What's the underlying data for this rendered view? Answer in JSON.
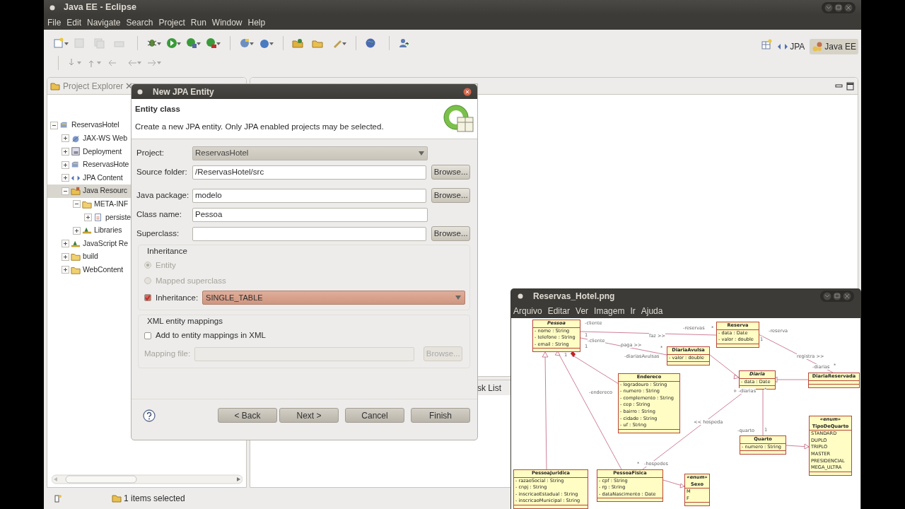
{
  "eclipse": {
    "title": "Java EE - Eclipse",
    "menu": [
      "File",
      "Edit",
      "Navigate",
      "Search",
      "Project",
      "Run",
      "Window",
      "Help"
    ],
    "perspectives": [
      {
        "label": "JPA",
        "selected": false
      },
      {
        "label": "Java EE",
        "selected": true
      }
    ],
    "project_explorer": {
      "title": "Project Explorer",
      "tree": [
        {
          "label": "ReservasHotel",
          "kind": "project",
          "expanded": true,
          "selected": false,
          "children": [
            {
              "label": "JAX-WS Web",
              "kind": "webservice",
              "expanded": false,
              "selected": false
            },
            {
              "label": "Deployment",
              "kind": "deployment",
              "expanded": false,
              "selected": false
            },
            {
              "label": "ReservasHote",
              "kind": "project",
              "expanded": false,
              "selected": false
            },
            {
              "label": "JPA Content",
              "kind": "jpa",
              "expanded": false,
              "selected": false
            },
            {
              "label": "Java Resourc",
              "kind": "resources",
              "expanded": true,
              "selected": true,
              "children": [
                {
                  "label": "META-INF",
                  "kind": "folder",
                  "expanded": true,
                  "selected": false,
                  "children": [
                    {
                      "label": "persiste",
                      "kind": "file",
                      "expanded": false,
                      "selected": false
                    }
                  ]
                },
                {
                  "label": "Libraries",
                  "kind": "library",
                  "expanded": false,
                  "selected": false
                }
              ]
            },
            {
              "label": "JavaScript Re",
              "kind": "library",
              "expanded": false,
              "selected": false
            },
            {
              "label": "build",
              "kind": "folder",
              "expanded": false,
              "selected": false
            },
            {
              "label": "WebContent",
              "kind": "folder",
              "expanded": false,
              "selected": false
            }
          ]
        }
      ]
    },
    "bottom_tab": "sk List",
    "status": "1 items selected"
  },
  "dialog": {
    "title": "New JPA Entity",
    "heading": "Entity class",
    "description": "Create a new JPA entity. Only JPA enabled projects may be selected.",
    "fields": [
      {
        "label": "Project:",
        "kind": "combo",
        "value": "ReservasHotel"
      },
      {
        "label": "Source folder:",
        "kind": "text",
        "value": "/ReservasHotel/src",
        "button": "Browse..."
      },
      {
        "label": "Java package:",
        "kind": "text",
        "value": "modelo",
        "button": "Browse..."
      },
      {
        "label": "Class name:",
        "kind": "text",
        "value": "Pessoa"
      },
      {
        "label": "Superclass:",
        "kind": "text",
        "button": "Browse..."
      }
    ],
    "inheritance": {
      "title": "Inheritance",
      "options": [
        {
          "label": "Entity",
          "selected": true,
          "disabled": true
        },
        {
          "label": "Mapped superclass",
          "selected": false,
          "disabled": true
        }
      ],
      "strategy": {
        "label": "Inheritance:",
        "checked": true,
        "value": "SINGLE_TABLE"
      }
    },
    "xml": {
      "title": "XML entity mappings",
      "add": {
        "label": "Add to entity mappings in XML",
        "checked": false
      },
      "mapping_file": {
        "label": "Mapping file:",
        "button": "Browse...",
        "disabled": true
      }
    },
    "buttons": [
      "< Back",
      "Next >",
      "Cancel",
      "Finish"
    ]
  },
  "viewer": {
    "title": "Reservas_Hotel.png",
    "menu": [
      "Arquivo",
      "Editar",
      "Ver",
      "Imagem",
      "Ir",
      "Ajuda"
    ],
    "diagram": {
      "classes": [
        {
          "name": "Pessoa",
          "abstract": true,
          "attributes": [
            "- nome : String",
            "- telefone : String",
            "- email : String"
          ]
        },
        {
          "name": "Reserva",
          "abstract": false,
          "attributes": [
            "- data : Date",
            "- valor : double"
          ]
        },
        {
          "name": "DiariaAvulsa",
          "abstract": false,
          "attributes": [
            "- valor : double"
          ]
        },
        {
          "name": "Endereco",
          "abstract": false,
          "attributes": [
            "- logradouro : String",
            "- numero : String",
            "- complemento : String",
            "- cep : String",
            "- bairro : String",
            "- cidade : String",
            "- uf : String"
          ]
        },
        {
          "name": "Diaria",
          "abstract": true,
          "attributes": [
            "- data : Date"
          ]
        },
        {
          "name": "DiariaReservada",
          "abstract": false
        },
        {
          "name": "Quarto",
          "abstract": false,
          "attributes": [
            "- numero : String"
          ]
        },
        {
          "name": "TipoDeQuarto",
          "stereotype": "«enum»",
          "abstract": false,
          "attributes": [
            "STANDARD",
            "DUPLO",
            "TRIPLO",
            "MASTER",
            "PRESIDENCIAL",
            "MEGA_ULTRA"
          ]
        },
        {
          "name": "PessoaJuridica",
          "abstract": false,
          "attributes": [
            "- razaoSocial : String",
            "- cnpj : String",
            "- inscricaoEstadual : String",
            "- inscricaoMunicipal : String"
          ]
        },
        {
          "name": "PessoaFisica",
          "abstract": false,
          "attributes": [
            "- cpf : String",
            "- rg : String",
            "- dataNascimento : Date"
          ]
        },
        {
          "name": "Sexo",
          "stereotype": "«enum»",
          "abstract": false,
          "attributes": [
            "M",
            "F"
          ]
        }
      ],
      "labels": [
        "-cliente",
        "1",
        "-cliente",
        "1",
        "-reservas",
        "*",
        "faz >>",
        "paga >>",
        "*",
        "-diariasAvulsas",
        "-reserva",
        "1",
        "registra >>",
        "-diarias",
        "*",
        "1",
        "-endereco",
        "+ -diarias",
        "*",
        "<< hospeda",
        "-quarto",
        "1",
        "*",
        "-hospedes"
      ]
    }
  }
}
